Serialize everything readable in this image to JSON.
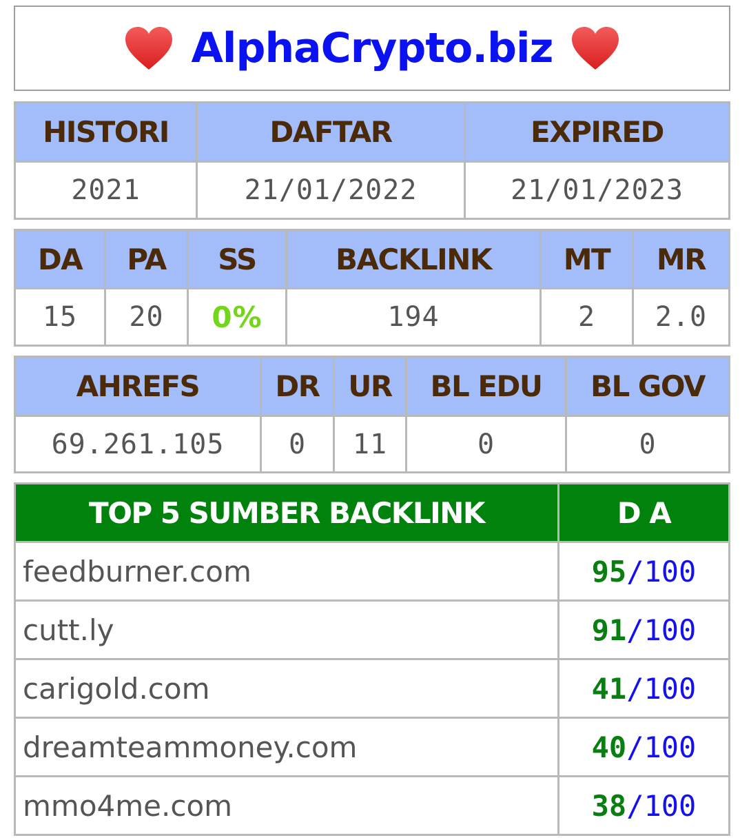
{
  "title": {
    "site": "AlphaCrypto.biz",
    "left_icon": "heart-icon",
    "right_icon": "heart-icon"
  },
  "table1": {
    "headers": [
      "HISTORI",
      "DAFTAR",
      "EXPIRED"
    ],
    "values": [
      "2021",
      "21/01/2022",
      "21/01/2023"
    ]
  },
  "table2": {
    "headers": [
      "DA",
      "PA",
      "SS",
      "BACKLINK",
      "MT",
      "MR"
    ],
    "values": [
      "15",
      "20",
      "0%",
      "194",
      "2",
      "2.0"
    ]
  },
  "table3": {
    "headers": [
      "AHREFS",
      "DR",
      "UR",
      "BL EDU",
      "BL GOV"
    ],
    "values": [
      "69.261.105",
      "0",
      "11",
      "0",
      "0"
    ]
  },
  "top5": {
    "headers": [
      "TOP 5 SUMBER BACKLINK",
      "D A"
    ],
    "rows": [
      {
        "site": "feedburner.com",
        "da": "95",
        "max": "/100"
      },
      {
        "site": "cutt.ly",
        "da": "91",
        "max": "/100"
      },
      {
        "site": "carigold.com",
        "da": "41",
        "max": "/100"
      },
      {
        "site": "dreamteammoney.com",
        "da": "40",
        "max": "/100"
      },
      {
        "site": "mmo4me.com",
        "da": "38",
        "max": "/100"
      }
    ]
  },
  "colors": {
    "site_title": "#0b12f2",
    "header_bg": "#a3bdfa",
    "header_text": "#4b2a0a",
    "green_header": "#00820c",
    "ss_value": "#74d61b",
    "da_value": "#0a7f11",
    "da_max": "#1411ee"
  }
}
